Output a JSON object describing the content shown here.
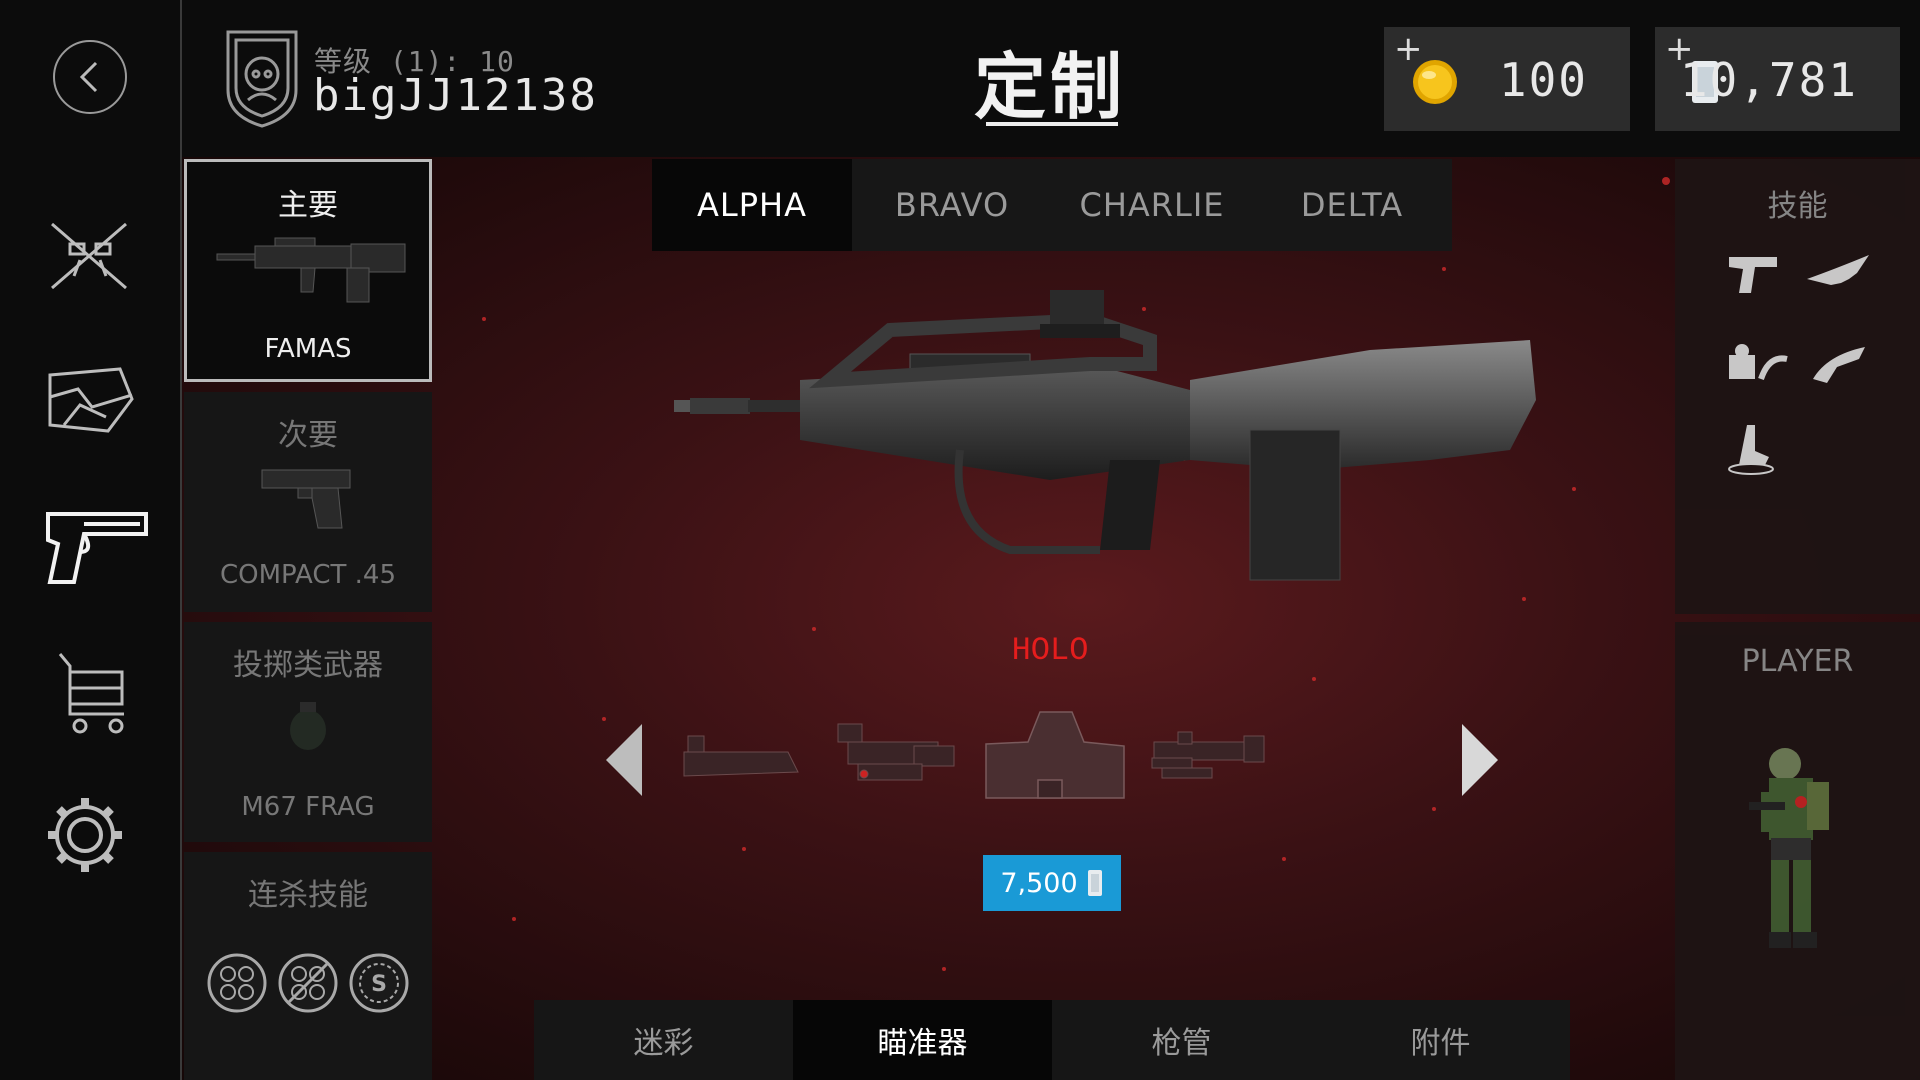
{
  "header": {
    "level_text": "等级 (1): 10",
    "player_name": "bigJJ12138",
    "page_title": "定制"
  },
  "currency": {
    "coins": "100",
    "cards": "10,781"
  },
  "nav": {
    "items": [
      "back-icon",
      "crossed-rifles-icon",
      "camo-icon",
      "pistol-icon",
      "cart-icon",
      "gear-icon"
    ],
    "active": "pistol-icon"
  },
  "loadout": {
    "primary": {
      "title": "主要",
      "name": "FAMAS"
    },
    "secondary": {
      "title": "次要",
      "name": "COMPACT .45"
    },
    "throwable": {
      "title": "投掷类武器",
      "name": "M67 FRAG"
    },
    "killstreak": {
      "title": "连杀技能"
    }
  },
  "loadout_tabs": [
    "ALPHA",
    "BRAVO",
    "CHARLIE",
    "DELTA"
  ],
  "active_loadout_tab": "ALPHA",
  "attachment": {
    "name": "HOLO",
    "price": "7,500",
    "options": [
      "rail-mount",
      "red-dot-sight",
      "holo-sight",
      "acog-scope"
    ],
    "selected": "holo-sight"
  },
  "category_tabs": [
    "迷彩",
    "瞄准器",
    "枪管",
    "附件"
  ],
  "active_category_tab": "瞄准器",
  "right_panel": {
    "skills_label": "技能",
    "player_label": "PLAYER"
  },
  "colors": {
    "accent_blue": "#1a9ad6",
    "attachment_red": "#e51d1d",
    "background_red": "#3a1114"
  }
}
